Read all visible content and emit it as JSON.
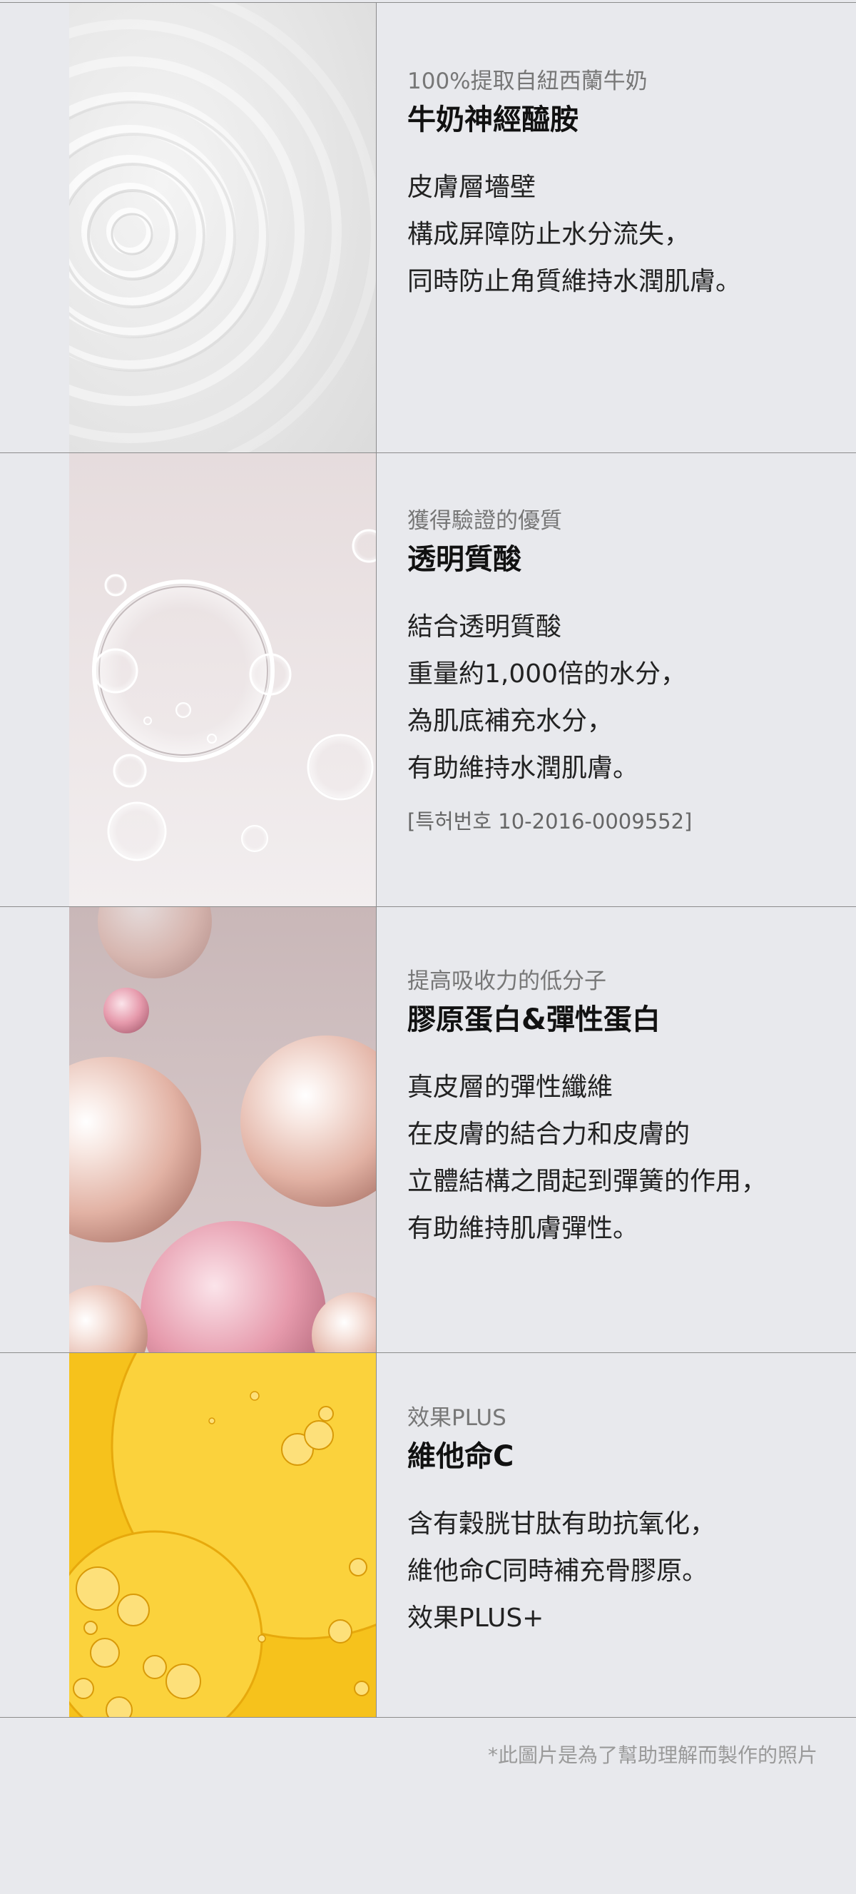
{
  "sections": [
    {
      "subtitle": "100%提取自紐西蘭牛奶",
      "title": "牛奶神經醯胺",
      "body": [
        "皮膚層墻壁",
        "構成屏障防止水分流失，",
        "同時防止角質維持水潤肌膚。"
      ]
    },
    {
      "subtitle": "獲得驗證的優質",
      "title": "透明質酸",
      "body": [
        "結合透明質酸",
        "重量約1,000倍的水分，",
        "為肌底補充水分，",
        "有助維持水潤肌膚。"
      ],
      "note": "[특허번호 10-2016-0009552]"
    },
    {
      "subtitle": "提高吸收力的低分子",
      "title": "膠原蛋白&彈性蛋白",
      "body": [
        "真皮層的彈性纖維",
        "在皮膚的結合力和皮膚的",
        "立體結構之間起到彈簧的作用，",
        "有助維持肌膚彈性。"
      ]
    },
    {
      "subtitle": "效果PLUS",
      "title": "維他命C",
      "body": [
        "含有穀胱甘肽有助抗氧化，",
        "維他命C同時補充骨膠原。",
        "效果PLUS+"
      ]
    }
  ],
  "disclaimer": "*此圖片是為了幫助理解而製作的照片",
  "images": [
    {
      "icon": "milk-ripple-image"
    },
    {
      "icon": "water-bubble-image"
    },
    {
      "icon": "pearl-spheres-image"
    },
    {
      "icon": "yellow-oil-bubbles-image"
    }
  ],
  "colors": {
    "background": "#e8e9ed",
    "divider": "#8c8c8c",
    "vitamin_yellow": "#f6c21c"
  }
}
